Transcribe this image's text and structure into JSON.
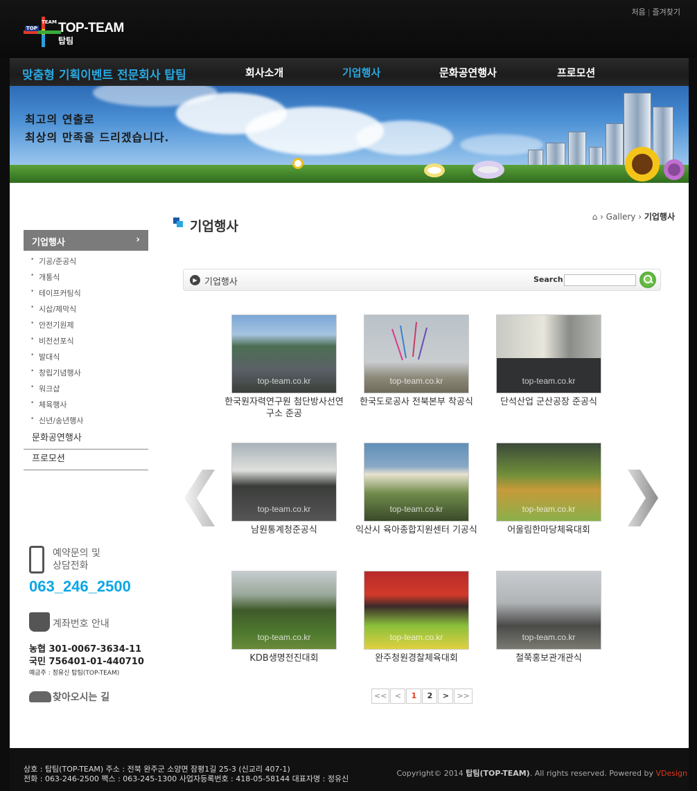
{
  "util": {
    "home": "처음",
    "favorite": "즐겨찾기"
  },
  "logo": {
    "name": "TOP-TEAM",
    "sub": "탑팀",
    "tag1": "TOP",
    "tag2": "TEAM"
  },
  "nav": {
    "slogan": "맞춤형 기획이벤트 전문회사 탑팀",
    "items": [
      "회사소개",
      "기업행사",
      "문화공연행사",
      "프로모션"
    ],
    "active": "기업행사"
  },
  "banner": {
    "line1": "최고의 연출로",
    "line2": "최상의 만족을 드리겠습니다."
  },
  "sidebar": {
    "header": "기업행사",
    "items": [
      "기공/준공식",
      "개통식",
      "테이프커팅식",
      "시삽/제막식",
      "안전기원제",
      "비전선포식",
      "발대식",
      "창립기념행사",
      "워크샵",
      "체육행사",
      "신년/송년행사"
    ],
    "sections": [
      "문화공연행사",
      "프로모션"
    ]
  },
  "contact": {
    "phone_label_1": "예약문의 및",
    "phone_label_2": "상담전화",
    "phone": "063_246_2500",
    "account_label": "계좌번호 안내",
    "bank1": "농협 301-0067-3634-11",
    "bank2": "국민 756401-01-440710",
    "holder": "예금주 : 정유신 탑팀(TOP-TEAM)",
    "directions": "찾아오시는 길"
  },
  "page": {
    "title": "기업행사",
    "breadcrumb": {
      "level1": "Gallery",
      "level2": "기업행사"
    }
  },
  "search": {
    "label": "기업행사",
    "search_label": "Search",
    "value": ""
  },
  "gallery": {
    "watermark": "top-team.co.kr",
    "items": [
      {
        "caption": "한국원자력연구원 첨단방사선연구소 준공"
      },
      {
        "caption": "한국도로공사 전북본부 착공식"
      },
      {
        "caption": "단석산업 군산공장 준공식"
      },
      {
        "caption": "남원통계청준공식"
      },
      {
        "caption": "익산시 육아종합지원센터 기공식"
      },
      {
        "caption": "어울림한마당체육대회"
      },
      {
        "caption": "KDB생명전진대회"
      },
      {
        "caption": "완주청원경찰체육대회"
      },
      {
        "caption": "철쭉홍보관개관식"
      }
    ]
  },
  "pager": {
    "first": "<<",
    "prev": "<",
    "pages": [
      "1",
      "2"
    ],
    "current": "1",
    "next": ">",
    "last": ">>"
  },
  "footer": {
    "line1": "상호 : 탑팀(TOP-TEAM) 주소 : 전북 완주군 소양면 잠평1길 25-3 (신교리 407-1)",
    "line2": "전화 : 063-246-2500 팩스 : 063-245-1300 사업자등록번호 : 418-05-58144 대표자명 : 정유신",
    "copy_prefix": "Copyright© 2014",
    "copy_company": "탑팀(TOP-TEAM)",
    "copy_suffix": ". All rights reserved. Powered by",
    "brand": "VDesign"
  },
  "colors": {
    "accent": "#2aa7e0",
    "phone": "#0aa6e6",
    "current_page": "#e03a1a"
  }
}
